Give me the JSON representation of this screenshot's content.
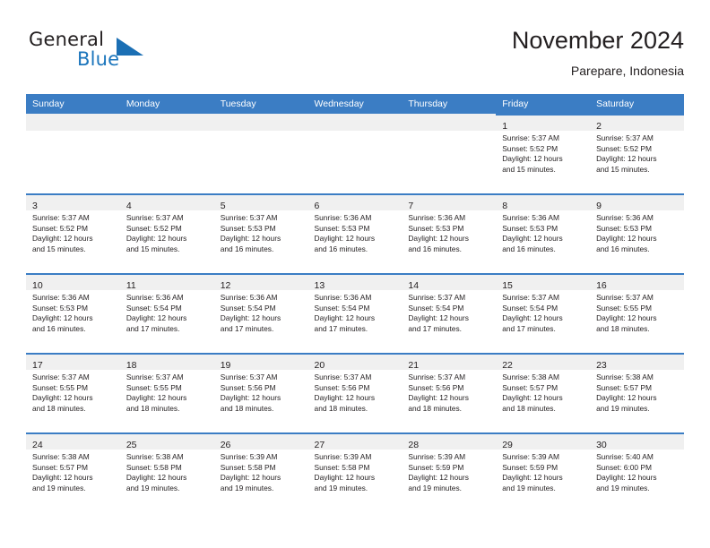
{
  "brand": {
    "name_part1": "General",
    "name_part2": "Blue",
    "triangle_icon": "triangle-icon",
    "accent_color": "#1b75bc"
  },
  "header": {
    "title": "November 2024",
    "subtitle": "Parepare, Indonesia"
  },
  "theme": {
    "header_bg": "#3b7dc4",
    "daynum_band_bg": "#f0f0f0",
    "text_color": "#231f20"
  },
  "calendar": {
    "weekday_headers": [
      "Sunday",
      "Monday",
      "Tuesday",
      "Wednesday",
      "Thursday",
      "Friday",
      "Saturday"
    ],
    "labels": {
      "sunrise": "Sunrise:",
      "sunset": "Sunset:",
      "daylight": "Daylight:"
    },
    "weeks": [
      [
        {
          "day": "",
          "empty": true
        },
        {
          "day": "",
          "empty": true
        },
        {
          "day": "",
          "empty": true
        },
        {
          "day": "",
          "empty": true
        },
        {
          "day": "",
          "empty": true
        },
        {
          "day": "1",
          "sunrise": "Sunrise: 5:37 AM",
          "sunset": "Sunset: 5:52 PM",
          "daylight_line1": "Daylight: 12 hours",
          "daylight_line2": "and 15 minutes."
        },
        {
          "day": "2",
          "sunrise": "Sunrise: 5:37 AM",
          "sunset": "Sunset: 5:52 PM",
          "daylight_line1": "Daylight: 12 hours",
          "daylight_line2": "and 15 minutes."
        }
      ],
      [
        {
          "day": "3",
          "sunrise": "Sunrise: 5:37 AM",
          "sunset": "Sunset: 5:52 PM",
          "daylight_line1": "Daylight: 12 hours",
          "daylight_line2": "and 15 minutes."
        },
        {
          "day": "4",
          "sunrise": "Sunrise: 5:37 AM",
          "sunset": "Sunset: 5:52 PM",
          "daylight_line1": "Daylight: 12 hours",
          "daylight_line2": "and 15 minutes."
        },
        {
          "day": "5",
          "sunrise": "Sunrise: 5:37 AM",
          "sunset": "Sunset: 5:53 PM",
          "daylight_line1": "Daylight: 12 hours",
          "daylight_line2": "and 16 minutes."
        },
        {
          "day": "6",
          "sunrise": "Sunrise: 5:36 AM",
          "sunset": "Sunset: 5:53 PM",
          "daylight_line1": "Daylight: 12 hours",
          "daylight_line2": "and 16 minutes."
        },
        {
          "day": "7",
          "sunrise": "Sunrise: 5:36 AM",
          "sunset": "Sunset: 5:53 PM",
          "daylight_line1": "Daylight: 12 hours",
          "daylight_line2": "and 16 minutes."
        },
        {
          "day": "8",
          "sunrise": "Sunrise: 5:36 AM",
          "sunset": "Sunset: 5:53 PM",
          "daylight_line1": "Daylight: 12 hours",
          "daylight_line2": "and 16 minutes."
        },
        {
          "day": "9",
          "sunrise": "Sunrise: 5:36 AM",
          "sunset": "Sunset: 5:53 PM",
          "daylight_line1": "Daylight: 12 hours",
          "daylight_line2": "and 16 minutes."
        }
      ],
      [
        {
          "day": "10",
          "sunrise": "Sunrise: 5:36 AM",
          "sunset": "Sunset: 5:53 PM",
          "daylight_line1": "Daylight: 12 hours",
          "daylight_line2": "and 16 minutes."
        },
        {
          "day": "11",
          "sunrise": "Sunrise: 5:36 AM",
          "sunset": "Sunset: 5:54 PM",
          "daylight_line1": "Daylight: 12 hours",
          "daylight_line2": "and 17 minutes."
        },
        {
          "day": "12",
          "sunrise": "Sunrise: 5:36 AM",
          "sunset": "Sunset: 5:54 PM",
          "daylight_line1": "Daylight: 12 hours",
          "daylight_line2": "and 17 minutes."
        },
        {
          "day": "13",
          "sunrise": "Sunrise: 5:36 AM",
          "sunset": "Sunset: 5:54 PM",
          "daylight_line1": "Daylight: 12 hours",
          "daylight_line2": "and 17 minutes."
        },
        {
          "day": "14",
          "sunrise": "Sunrise: 5:37 AM",
          "sunset": "Sunset: 5:54 PM",
          "daylight_line1": "Daylight: 12 hours",
          "daylight_line2": "and 17 minutes."
        },
        {
          "day": "15",
          "sunrise": "Sunrise: 5:37 AM",
          "sunset": "Sunset: 5:54 PM",
          "daylight_line1": "Daylight: 12 hours",
          "daylight_line2": "and 17 minutes."
        },
        {
          "day": "16",
          "sunrise": "Sunrise: 5:37 AM",
          "sunset": "Sunset: 5:55 PM",
          "daylight_line1": "Daylight: 12 hours",
          "daylight_line2": "and 18 minutes."
        }
      ],
      [
        {
          "day": "17",
          "sunrise": "Sunrise: 5:37 AM",
          "sunset": "Sunset: 5:55 PM",
          "daylight_line1": "Daylight: 12 hours",
          "daylight_line2": "and 18 minutes."
        },
        {
          "day": "18",
          "sunrise": "Sunrise: 5:37 AM",
          "sunset": "Sunset: 5:55 PM",
          "daylight_line1": "Daylight: 12 hours",
          "daylight_line2": "and 18 minutes."
        },
        {
          "day": "19",
          "sunrise": "Sunrise: 5:37 AM",
          "sunset": "Sunset: 5:56 PM",
          "daylight_line1": "Daylight: 12 hours",
          "daylight_line2": "and 18 minutes."
        },
        {
          "day": "20",
          "sunrise": "Sunrise: 5:37 AM",
          "sunset": "Sunset: 5:56 PM",
          "daylight_line1": "Daylight: 12 hours",
          "daylight_line2": "and 18 minutes."
        },
        {
          "day": "21",
          "sunrise": "Sunrise: 5:37 AM",
          "sunset": "Sunset: 5:56 PM",
          "daylight_line1": "Daylight: 12 hours",
          "daylight_line2": "and 18 minutes."
        },
        {
          "day": "22",
          "sunrise": "Sunrise: 5:38 AM",
          "sunset": "Sunset: 5:57 PM",
          "daylight_line1": "Daylight: 12 hours",
          "daylight_line2": "and 18 minutes."
        },
        {
          "day": "23",
          "sunrise": "Sunrise: 5:38 AM",
          "sunset": "Sunset: 5:57 PM",
          "daylight_line1": "Daylight: 12 hours",
          "daylight_line2": "and 19 minutes."
        }
      ],
      [
        {
          "day": "24",
          "sunrise": "Sunrise: 5:38 AM",
          "sunset": "Sunset: 5:57 PM",
          "daylight_line1": "Daylight: 12 hours",
          "daylight_line2": "and 19 minutes."
        },
        {
          "day": "25",
          "sunrise": "Sunrise: 5:38 AM",
          "sunset": "Sunset: 5:58 PM",
          "daylight_line1": "Daylight: 12 hours",
          "daylight_line2": "and 19 minutes."
        },
        {
          "day": "26",
          "sunrise": "Sunrise: 5:39 AM",
          "sunset": "Sunset: 5:58 PM",
          "daylight_line1": "Daylight: 12 hours",
          "daylight_line2": "and 19 minutes."
        },
        {
          "day": "27",
          "sunrise": "Sunrise: 5:39 AM",
          "sunset": "Sunset: 5:58 PM",
          "daylight_line1": "Daylight: 12 hours",
          "daylight_line2": "and 19 minutes."
        },
        {
          "day": "28",
          "sunrise": "Sunrise: 5:39 AM",
          "sunset": "Sunset: 5:59 PM",
          "daylight_line1": "Daylight: 12 hours",
          "daylight_line2": "and 19 minutes."
        },
        {
          "day": "29",
          "sunrise": "Sunrise: 5:39 AM",
          "sunset": "Sunset: 5:59 PM",
          "daylight_line1": "Daylight: 12 hours",
          "daylight_line2": "and 19 minutes."
        },
        {
          "day": "30",
          "sunrise": "Sunrise: 5:40 AM",
          "sunset": "Sunset: 6:00 PM",
          "daylight_line1": "Daylight: 12 hours",
          "daylight_line2": "and 19 minutes."
        }
      ]
    ]
  }
}
